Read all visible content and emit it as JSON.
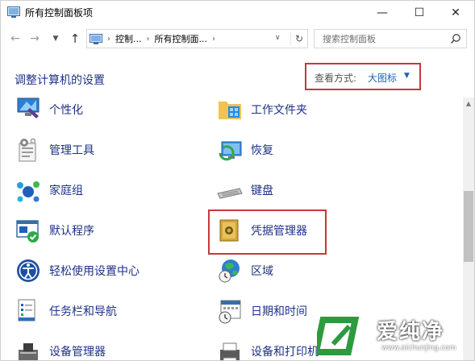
{
  "window": {
    "title": "所有控制面板项",
    "minimize_glyph": "—",
    "maximize_glyph": "☐",
    "close_glyph": "✕"
  },
  "navbar": {
    "breadcrumbs": [
      "控制...",
      "所有控制面..."
    ],
    "search_placeholder": "搜索控制面板"
  },
  "header": {
    "title": "调整计算机的设置",
    "view_label": "查看方式:",
    "view_value": "大图标"
  },
  "items_left": [
    {
      "label": "个性化",
      "icon": "personalization-icon"
    },
    {
      "label": "管理工具",
      "icon": "admin-tools-icon"
    },
    {
      "label": "家庭组",
      "icon": "homegroup-icon"
    },
    {
      "label": "默认程序",
      "icon": "default-programs-icon"
    },
    {
      "label": "轻松使用设置中心",
      "icon": "ease-of-access-icon"
    },
    {
      "label": "任务栏和导航",
      "icon": "taskbar-icon"
    },
    {
      "label": "设备管理器",
      "icon": "device-manager-icon"
    }
  ],
  "items_right": [
    {
      "label": "工作文件夹",
      "icon": "work-folders-icon"
    },
    {
      "label": "恢复",
      "icon": "recovery-icon"
    },
    {
      "label": "键盘",
      "icon": "keyboard-icon"
    },
    {
      "label": "凭据管理器",
      "icon": "credential-manager-icon"
    },
    {
      "label": "区域",
      "icon": "region-icon"
    },
    {
      "label": "日期和时间",
      "icon": "date-time-icon"
    },
    {
      "label": "设备和打印机",
      "icon": "devices-printers-icon"
    }
  ],
  "watermark": {
    "text": "爱纯净",
    "url": "www.aichunjing.com"
  },
  "colors": {
    "link": "#1e3287",
    "accent": "#1d64b3",
    "highlight": "#c7373a"
  }
}
